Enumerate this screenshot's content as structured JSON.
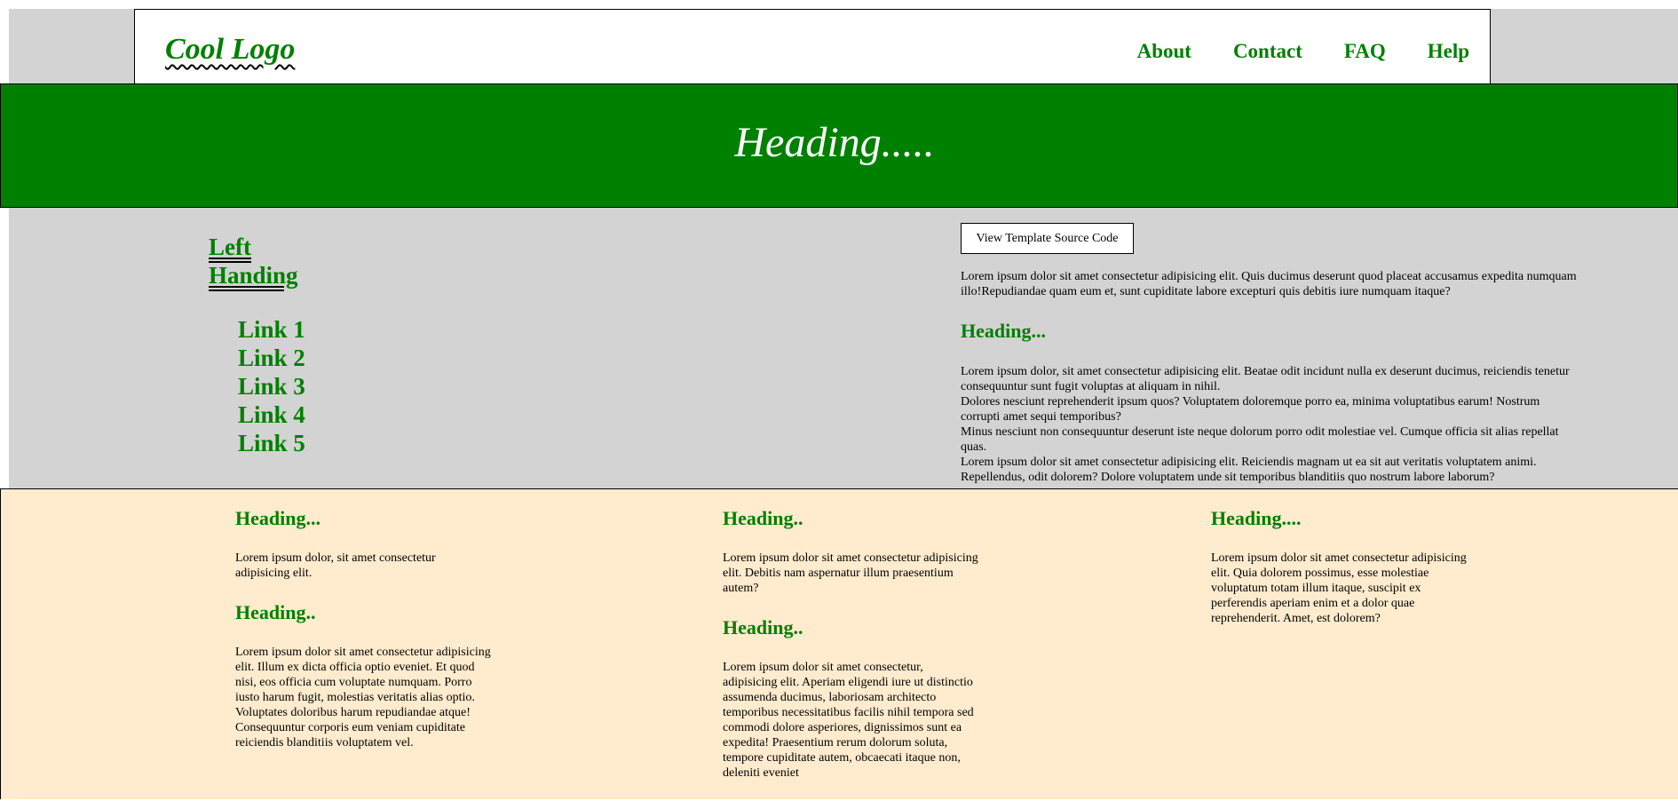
{
  "header": {
    "logo": "Cool Logo",
    "nav": [
      "About",
      "Contact",
      "FAQ",
      "Help"
    ]
  },
  "hero": {
    "title": "Heading....."
  },
  "sidebar": {
    "heading_line1": "Left",
    "heading_line2": "Handing",
    "links": [
      "Link 1",
      "Link 2",
      "Link 3",
      "Link 4",
      "Link 5"
    ]
  },
  "main": {
    "button_label": "View Template Source Code",
    "intro": "Lorem ipsum dolor sit amet consectetur adipisicing elit. Quis ducimus deserunt quod placeat accusamus expedita numquam illo!Repudiandae quam eum et, sunt cupiditate labore excepturi quis debitis iure numquam itaque?",
    "heading": "Heading...",
    "paragraphs": [
      "Lorem ipsum dolor, sit amet consectetur adipisicing elit. Beatae odit incidunt nulla ex deserunt ducimus, reiciendis tenetur consequuntur sunt fugit voluptas at aliquam in nihil.",
      "Dolores nesciunt reprehenderit ipsum quos? Voluptatem doloremque porro ea, minima voluptatibus earum! Nostrum corrupti amet sequi temporibus?",
      "Minus nesciunt non consequuntur deserunt iste neque dolorum porro odit molestiae vel. Cumque officia sit alias repellat quas.",
      "Lorem ipsum dolor sit amet consectetur adipisicing elit. Reiciendis magnam ut ea sit aut veritatis voluptatem animi. Repellendus, odit dolorem? Dolore voluptatem unde sit temporibus blanditiis quo nostrum labore laborum?"
    ]
  },
  "footer": {
    "col1": {
      "heading1": "Heading...",
      "text1": "Lorem ipsum dolor, sit amet consectetur adipisicing elit.",
      "heading2": "Heading..",
      "text2": "Lorem ipsum dolor sit amet consectetur adipisicing elit. Illum ex dicta officia optio eveniet. Et quod nisi, eos officia cum voluptate numquam. Porro iusto harum fugit, molestias veritatis alias optio. Voluptates doloribus harum repudiandae atque! Consequuntur corporis eum veniam cupiditate reiciendis blanditiis voluptatem vel."
    },
    "col2": {
      "heading1": "Heading..",
      "text1": "Lorem ipsum dolor sit amet consectetur adipisicing elit. Debitis nam aspernatur illum praesentium autem?",
      "heading2": "Heading..",
      "text2": "Lorem ipsum dolor sit amet consectetur, adipisicing elit. Aperiam eligendi iure ut distinctio assumenda ducimus, laboriosam architecto temporibus necessitatibus facilis nihil tempora sed commodi dolore asperiores, dignissimos sunt ea expedita! Praesentium rerum dolorum soluta, tempore cupiditate autem, obcaecati itaque non, deleniti eveniet"
    },
    "col3": {
      "heading1": "Heading....",
      "text1": "Lorem ipsum dolor sit amet consectetur adipisicing elit. Quia dolorem possimus, esse molestiae voluptatum totam illum itaque, suscipit ex perferendis aperiam enim et a dolor quae reprehenderit. Amet, est dolorem?"
    }
  },
  "colors": {
    "accent_green": "#008000",
    "page_grey": "#d3d3d3",
    "footer_bg": "#ffebcd",
    "hero_text": "#ffffff"
  }
}
